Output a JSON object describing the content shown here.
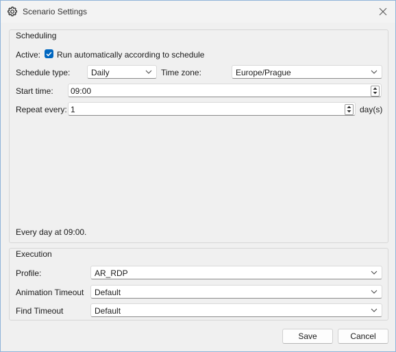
{
  "window": {
    "title": "Scenario Settings"
  },
  "scheduling": {
    "group_title": "Scheduling",
    "active_label": "Active:",
    "active_checked": true,
    "active_text": "Run automatically according to schedule",
    "schedule_type_label": "Schedule type:",
    "schedule_type_value": "Daily",
    "time_zone_label": "Time zone:",
    "time_zone_value": "Europe/Prague",
    "start_time_label": "Start time:",
    "start_time_value": "09:00",
    "repeat_label": "Repeat every:",
    "repeat_value": "1",
    "repeat_unit": "day(s)",
    "summary": "Every day at 09:00."
  },
  "execution": {
    "group_title": "Execution",
    "profile_label": "Profile:",
    "profile_value": "AR_RDP",
    "animation_timeout_label": "Animation Timeout",
    "animation_timeout_value": "Default",
    "find_timeout_label": "Find Timeout",
    "find_timeout_value": "Default"
  },
  "buttons": {
    "save": "Save",
    "cancel": "Cancel"
  },
  "colors": {
    "accent": "#0067c0",
    "window_bg": "#f0f0f0",
    "border": "#8fb3d9"
  },
  "icons": {
    "title": "gear-icon",
    "close": "close-icon",
    "dropdown": "chevron-down-icon"
  }
}
